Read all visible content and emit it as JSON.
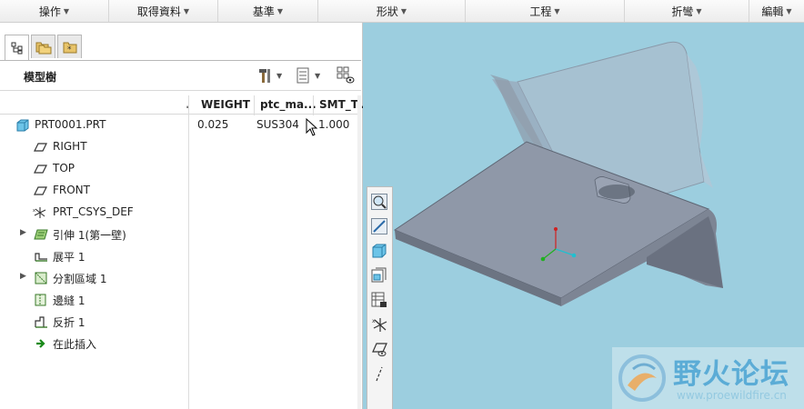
{
  "menubar": {
    "items": [
      {
        "label": "操作"
      },
      {
        "label": "取得資料"
      },
      {
        "label": "基準"
      },
      {
        "label": "形狀"
      },
      {
        "label": "工程"
      },
      {
        "label": "折彎"
      },
      {
        "label": "編輯"
      }
    ]
  },
  "panel": {
    "title": "模型樹",
    "tabs": [
      {
        "icon": "model-tree-icon"
      },
      {
        "icon": "folder-browser-icon"
      },
      {
        "icon": "favorites-icon"
      }
    ]
  },
  "columns": {
    "weight": "WEIGHT",
    "material": "ptc_ma...",
    "thickness": "SMT_T..."
  },
  "tree": {
    "root": {
      "label": "PRT0001.PRT",
      "weight": "0.025",
      "material": "SUS304",
      "thickness": "1.000"
    },
    "items": [
      {
        "label": "RIGHT",
        "icon": "datum-plane-icon"
      },
      {
        "label": "TOP",
        "icon": "datum-plane-icon"
      },
      {
        "label": "FRONT",
        "icon": "datum-plane-icon"
      },
      {
        "label": "PRT_CSYS_DEF",
        "icon": "csys-icon"
      },
      {
        "label": "引伸 1(第一壁)",
        "icon": "extrude-wall-icon"
      },
      {
        "label": "展平 1",
        "icon": "unbend-icon"
      },
      {
        "label": "分割區域 1",
        "icon": "split-area-icon"
      },
      {
        "label": "邊縫 1",
        "icon": "edge-rip-icon"
      },
      {
        "label": "反折 1",
        "icon": "bend-back-icon"
      },
      {
        "label": "在此插入",
        "icon": "insert-here-icon"
      }
    ]
  },
  "watermark": {
    "title": "野火论坛",
    "url": "www.proewildfire.cn"
  },
  "colors": {
    "viewport_bg": "#9ccedf",
    "part_top": "#8f98a8",
    "part_side": "#6c7482",
    "glass": "#a9bccc"
  }
}
